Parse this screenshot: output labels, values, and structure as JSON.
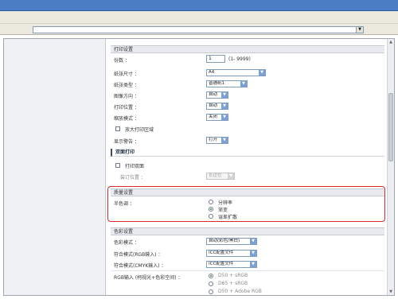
{
  "address_bar": {
    "value": ""
  },
  "print_settings": {
    "header": "打印设置",
    "copies": {
      "label": "份数 ：",
      "value": "1",
      "range": "(1- 9999)"
    },
    "paper_size": {
      "label": "纸张尺寸 ：",
      "value": "A4"
    },
    "paper_type": {
      "label": "纸张类型 ：",
      "value": "普通纸1"
    },
    "orientation": {
      "label": "图像方向 ：",
      "value": "自动"
    },
    "print_position": {
      "label": "打印位置 ：",
      "value": "自动"
    },
    "zoom_mode": {
      "label": "缩放模式 ：",
      "value": "关闭"
    },
    "enlarge_area": {
      "label": "放大打印区域",
      "checked": false
    },
    "display_warning": {
      "label": "显示警告 ：",
      "value": "打开"
    }
  },
  "duplex": {
    "header": "双面打印",
    "print_duplex": {
      "label": "打印双面",
      "checked": false
    },
    "binding_position": {
      "label": "装订位置 ：",
      "value": "长边位"
    }
  },
  "quality": {
    "header": "质量设置",
    "halftone_label": "半色调 ：",
    "options": [
      {
        "label": "分辨率",
        "selected": false
      },
      {
        "label": "渐变",
        "selected": true
      },
      {
        "label": "误差扩散",
        "selected": false
      }
    ]
  },
  "color": {
    "header": "色彩设置",
    "color_mode": {
      "label": "色彩模式 ：",
      "value": "自动(彩色/黑白)"
    },
    "match_rgb": {
      "label": "符合模式(RGB输入) ：",
      "value": "ICC配置文件"
    },
    "match_cmyk": {
      "label": "符合模式(CMYK输入) ：",
      "value": "ICC配置文件"
    },
    "rgb_input": {
      "label": "RGB输入 (柯视光+色彩空间) ：",
      "options": [
        {
          "label": "D50 + sRGB",
          "selected": true
        },
        {
          "label": "D65 + sRGB",
          "selected": false
        },
        {
          "label": "D50 + Adobe RGB",
          "selected": false
        }
      ]
    }
  },
  "icons": {
    "dropdown": "chevron-down-icon",
    "scroll_up": "arrow-up-icon",
    "scroll_down": "arrow-down-icon"
  },
  "colors": {
    "highlight": "#d42b2b",
    "accent": "#4a7fc6"
  }
}
